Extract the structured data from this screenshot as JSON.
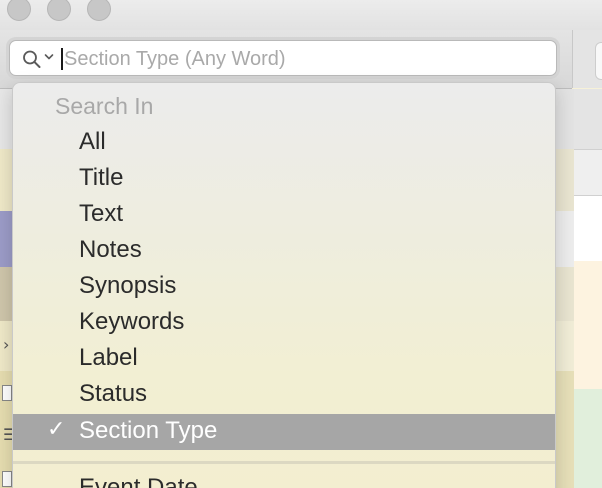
{
  "window": {
    "traffic_lights": [
      "close",
      "minimize",
      "zoom"
    ]
  },
  "search": {
    "value": "",
    "placeholder": "Section Type (Any Word)",
    "icon": "magnifier-with-dropdown"
  },
  "menu": {
    "header": "Search In",
    "items": [
      {
        "label": "All",
        "checked": false
      },
      {
        "label": "Title",
        "checked": false
      },
      {
        "label": "Text",
        "checked": false
      },
      {
        "label": "Notes",
        "checked": false
      },
      {
        "label": "Synopsis",
        "checked": false
      },
      {
        "label": "Keywords",
        "checked": false
      },
      {
        "label": "Label",
        "checked": false
      },
      {
        "label": "Status",
        "checked": false
      },
      {
        "label": "Section Type",
        "checked": true
      }
    ],
    "check_mark": "✓",
    "partial_item": "Event Date"
  },
  "colors": {
    "selection": "#a6a6a6",
    "menu_text": "#2b2b2b",
    "header_text": "#a8a8a8",
    "placeholder": "#a9a9a9"
  }
}
